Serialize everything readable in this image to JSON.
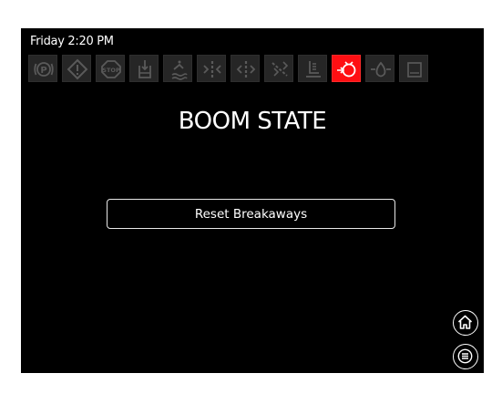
{
  "status_bar": {
    "datetime": "Friday 2:20 PM"
  },
  "telltales": [
    {
      "name": "parking-brake-icon",
      "active": false,
      "text": "(P)"
    },
    {
      "name": "warning-icon",
      "active": false,
      "text": "!"
    },
    {
      "name": "stop-icon",
      "active": false,
      "text": "STOP"
    },
    {
      "name": "tank-fill-icon",
      "active": false
    },
    {
      "name": "rinse-tank-icon",
      "active": false
    },
    {
      "name": "boom-fold-icon",
      "active": false
    },
    {
      "name": "boom-unfold-icon",
      "active": false
    },
    {
      "name": "boom-tilt-icon",
      "active": false
    },
    {
      "name": "boom-height-icon",
      "active": false
    },
    {
      "name": "boom-breakaway-icon",
      "active": true
    },
    {
      "name": "pump-icon",
      "active": false
    },
    {
      "name": "display-icon",
      "active": false
    }
  ],
  "screen": {
    "title": "BOOM STATE",
    "reset_button_label": "Reset Breakaways"
  },
  "nav": {
    "home_icon": "home-icon",
    "menu_icon": "menu-icon"
  },
  "colors": {
    "background": "#000000",
    "telltale_inactive": "#262626",
    "telltale_icon_inactive": "#5a5a5a",
    "telltale_active": "#ff0f13",
    "text": "#ffffff"
  }
}
